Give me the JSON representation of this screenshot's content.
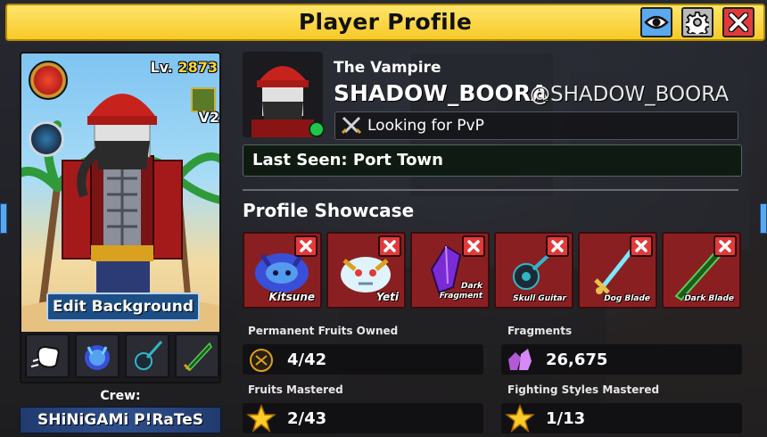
{
  "window": {
    "title": "Player Profile",
    "buttons": {
      "eye": "eye-icon",
      "settings": "gear-icon",
      "close": "close-icon"
    }
  },
  "card": {
    "level_prefix": "Lv.",
    "level": "2873",
    "race_version": "V2",
    "edit_background_label": "Edit Background",
    "slots": [
      "fighting-style-icon",
      "kitsune-fruit-icon",
      "skull-guitar-icon",
      "dark-blade-icon"
    ],
    "crew_label": "Crew:",
    "crew_name": "SHiNiGAMi P!RaTeS"
  },
  "profile": {
    "title": "The Vampire",
    "username": "SHADOW_BOORA",
    "handle": "@SHADOW_BOORA",
    "online": true,
    "status": "Looking for PvP",
    "last_seen_label": "Last Seen:",
    "last_seen_location": "Port Town"
  },
  "showcase": {
    "title": "Profile Showcase",
    "items": [
      {
        "label": "Kitsune",
        "color": "#3a4fd8"
      },
      {
        "label": "Yeti",
        "color": "#8fd6f0"
      },
      {
        "label": "Dark Fragment",
        "line1": "Dark",
        "line2": "Fragment",
        "color": "#7b2bd6"
      },
      {
        "label": "Skull Guitar",
        "color": "#2fb7c8"
      },
      {
        "label": "Dog Blade",
        "color": "#e6c04a"
      },
      {
        "label": "Dark Blade",
        "color": "#2e8a2e"
      }
    ]
  },
  "stats": {
    "permanent_fruits_label": "Permanent Fruits Owned",
    "permanent_fruits_value": "4/42",
    "fragments_label": "Fragments",
    "fragments_value": "26,675",
    "fruits_mastered_label": "Fruits Mastered",
    "fruits_mastered_value": "2/43",
    "fighting_styles_label": "Fighting Styles Mastered",
    "fighting_styles_value": "1/13"
  },
  "colors": {
    "title_bar": "#f6c928",
    "showcase_tile": "#8a1f22",
    "close_red": "#e23a3a",
    "level_gold": "#ffd33a",
    "online_green": "#1ec84a"
  }
}
